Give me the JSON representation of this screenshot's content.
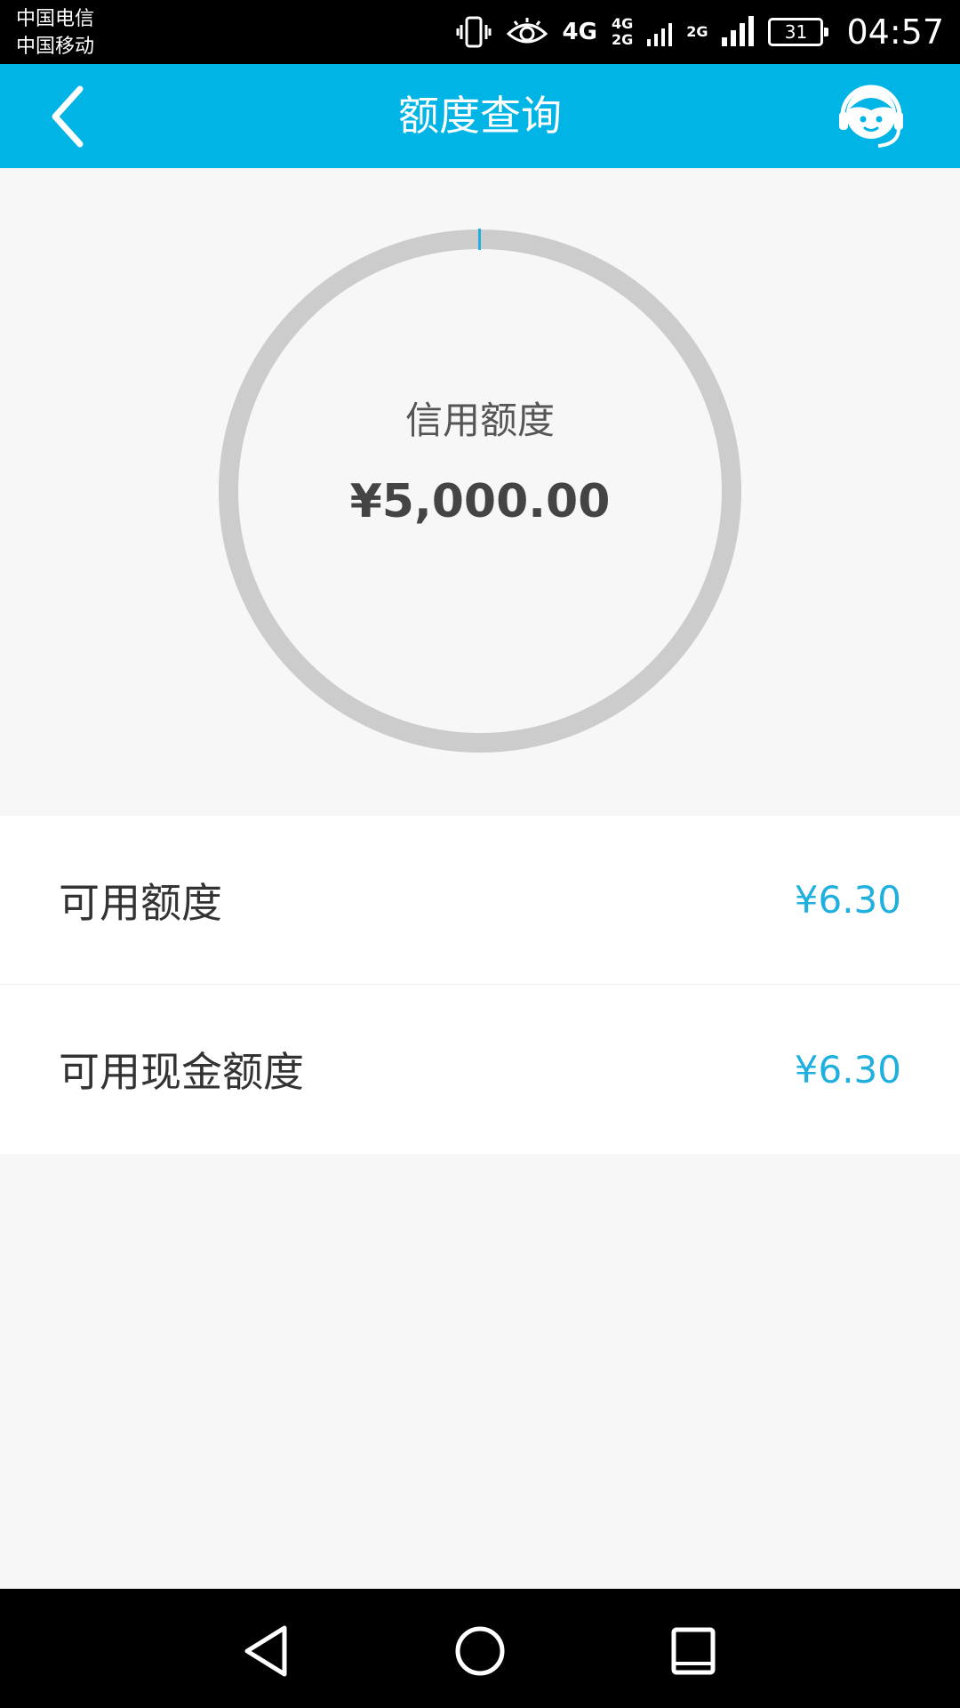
{
  "status_bar": {
    "carrier_1": "中国电信",
    "carrier_2": "中国移动",
    "net_4g": "4G",
    "net_4g_small": "4G",
    "net_2g_small": "2G",
    "net_2g_small_b": "2G",
    "battery": "31",
    "time": "04:57"
  },
  "header": {
    "title": "额度查询"
  },
  "credit": {
    "label": "信用额度",
    "amount": "¥5,000.00",
    "ring_color": "#cccccc",
    "accent_color": "#1fb0df"
  },
  "limits": [
    {
      "label": "可用额度",
      "value": "¥6.30"
    },
    {
      "label": "可用现金额度",
      "value": "¥6.30"
    }
  ],
  "colors": {
    "brand": "#00b4e6"
  }
}
